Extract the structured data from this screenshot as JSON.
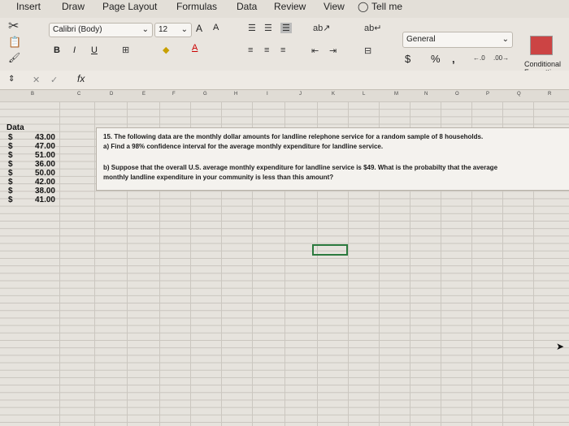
{
  "ribbon_tabs": [
    "Insert",
    "Draw",
    "Page Layout",
    "Formulas",
    "Data",
    "Review",
    "View",
    "Tell me"
  ],
  "font": {
    "name": "Calibri (Body)",
    "size": "12",
    "grow": "A",
    "shrink": "A"
  },
  "format": {
    "bold": "B",
    "italic": "I",
    "underline": "U",
    "number_format": "General",
    "currency": "$",
    "percent": "%",
    "comma": ","
  },
  "conditional_formatting": [
    "Conditional",
    "Formatting"
  ],
  "formula_bar": {
    "fx": "fx",
    "cancel": "✕",
    "confirm": "✓"
  },
  "column_headers": [
    "B",
    "C",
    "D",
    "E",
    "F",
    "G",
    "H",
    "I",
    "J",
    "K",
    "L",
    "M",
    "N",
    "O",
    "P",
    "Q",
    "R"
  ],
  "data": {
    "header": "Data",
    "currency_symbol": "$",
    "values": [
      "43.00",
      "47.00",
      "51.00",
      "36.00",
      "50.00",
      "42.00",
      "38.00",
      "41.00"
    ]
  },
  "problem": {
    "line1": "15. The following data are the monthly dollar amounts for landline relephone service for a random sample of 8 households.",
    "line2": "a) Find a 98% confidence interval for the average monthly expenditure for landline service.",
    "line3": "b) Suppose that the overall U.S. average monthly expenditure for landline service is $49. What is the probabilty that the average",
    "line4": "monthly landline expenditure in your community is less than this amount?"
  },
  "colors": {
    "ribbon": "#e9e5df",
    "grid": "#e6e3dd",
    "selection": "#2b7a3e"
  }
}
